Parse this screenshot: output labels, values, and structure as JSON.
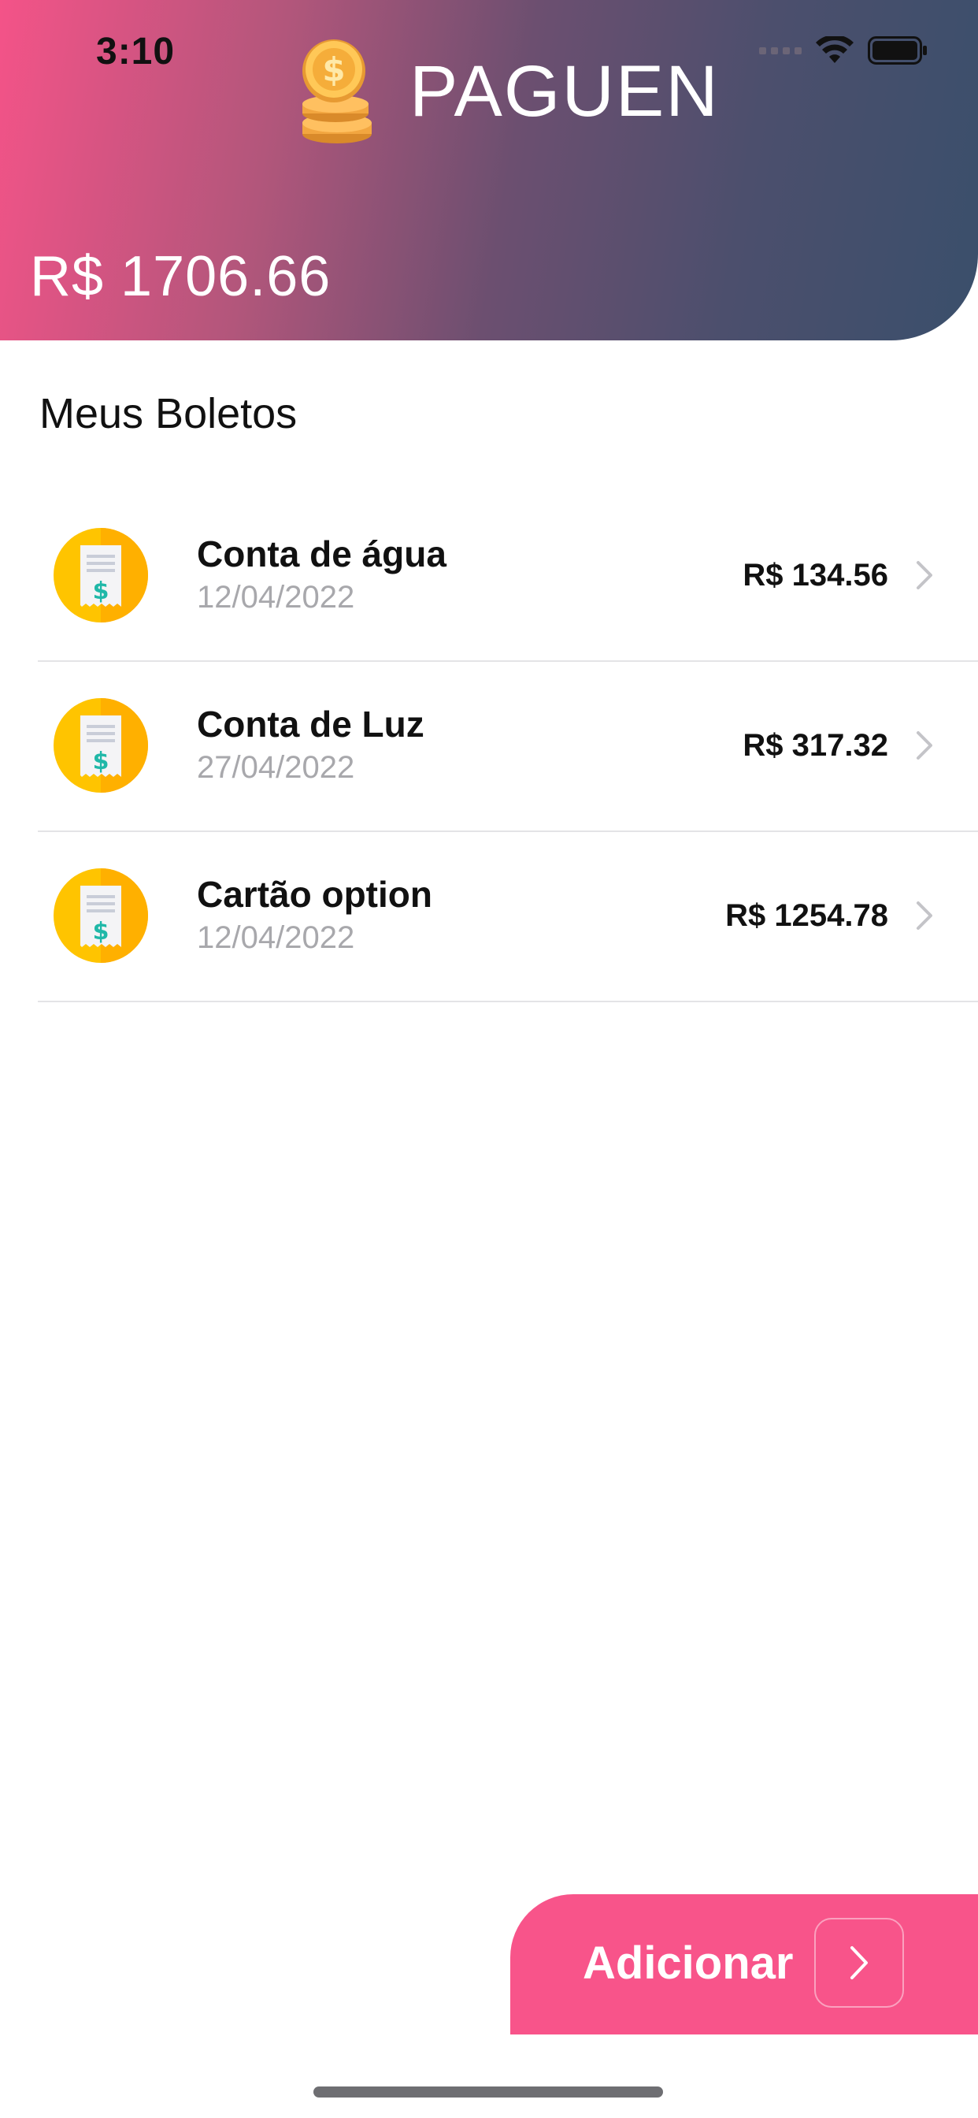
{
  "status_bar": {
    "time": "3:10"
  },
  "header": {
    "app_name": "PAGUEN",
    "balance": "R$ 1706.66",
    "logo_icon": "coins-stack-icon"
  },
  "section": {
    "title": "Meus Boletos"
  },
  "bills": [
    {
      "title": "Conta de água",
      "date": "12/04/2022",
      "amount": "R$ 134.56",
      "icon": "receipt-dollar-icon"
    },
    {
      "title": "Conta de Luz",
      "date": "27/04/2022",
      "amount": "R$ 317.32",
      "icon": "receipt-dollar-icon"
    },
    {
      "title": "Cartão option",
      "date": "12/04/2022",
      "amount": "R$ 1254.78",
      "icon": "receipt-dollar-icon"
    }
  ],
  "add_button": {
    "label": "Adicionar",
    "icon": "chevron-right-icon"
  },
  "colors": {
    "accent_pink": "#f8548a",
    "header_gradient_start": "#f45388",
    "header_gradient_end": "#3a4f6b",
    "icon_yellow": "#ffc400",
    "dollar_teal": "#20b8a8"
  }
}
